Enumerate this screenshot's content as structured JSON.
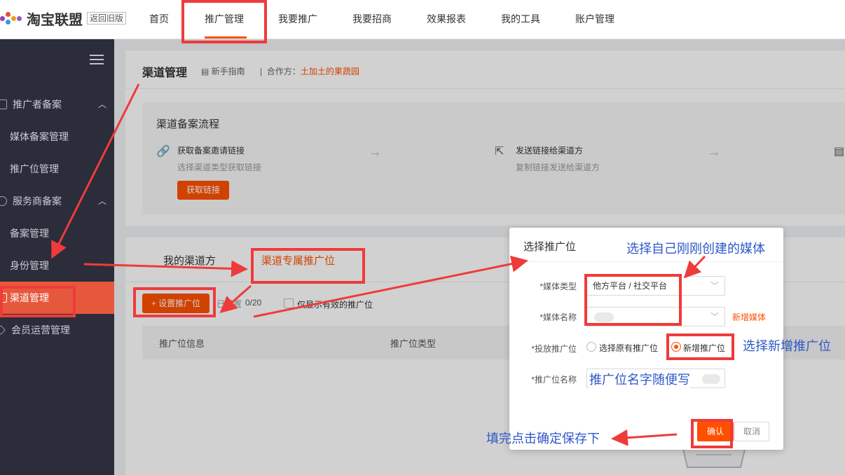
{
  "colors": {
    "accent": "#ff5000",
    "sidebar_bg": "#2b2d3b",
    "annotation_red": "#ef3b3b",
    "annotation_blue": "#2f58c8"
  },
  "header": {
    "logo_text": "淘宝联盟",
    "back_old": "返回旧版",
    "nav": [
      "首页",
      "推广管理",
      "我要推广",
      "我要招商",
      "效果报表",
      "我的工具",
      "账户管理"
    ]
  },
  "sidebar": {
    "items": [
      {
        "label": "推广者备案",
        "icon": "megaphone-icon"
      },
      {
        "label": "媒体备案管理"
      },
      {
        "label": "推广位管理"
      },
      {
        "label": "服务商备案",
        "icon": "service-icon"
      },
      {
        "label": "备案管理"
      },
      {
        "label": "身份管理"
      },
      {
        "label": "渠道管理",
        "icon": "channel-icon"
      },
      {
        "label": "会员运营管理",
        "icon": "member-icon"
      }
    ]
  },
  "page": {
    "title": "渠道管理",
    "guide": "新手指南",
    "partner_label": "合作方：",
    "partner_value": "土加土的果蔬园"
  },
  "flow": {
    "title": "渠道备案流程",
    "step1_title": "获取备案邀请链接",
    "step1_sub": "选择渠道类型获取链接",
    "step1_button": "获取链接",
    "step2_title": "发送链接给渠道方",
    "step2_sub": "复制链接发送给渠道方"
  },
  "channel": {
    "tab1": "我的渠道方",
    "tab2": "渠道专属推广位",
    "set_button": "+ 设置推广位",
    "set_count_label": "已设置",
    "set_count": "0/20",
    "only_valid": "仅显示有效的推广位",
    "col1": "推广位信息",
    "col2": "推广位类型"
  },
  "modal": {
    "title": "选择推广位",
    "media_type_label": "*媒体类型",
    "media_type_value": "他方平台 / 社交平台",
    "media_name_label": "*媒体名称",
    "add_media": "新增媒体",
    "placement_label": "*投放推广位",
    "option_existing": "选择原有推广位",
    "option_new": "新增推广位",
    "pid_name_label": "*推广位名称",
    "confirm": "确认",
    "cancel": "取消"
  },
  "annotations": {
    "choose_media": "选择自己刚刚创建的媒体",
    "choose_new": "选择新增推广位",
    "name_hint": "推广位名字随便写",
    "save_hint": "填完点击确定保存下"
  }
}
